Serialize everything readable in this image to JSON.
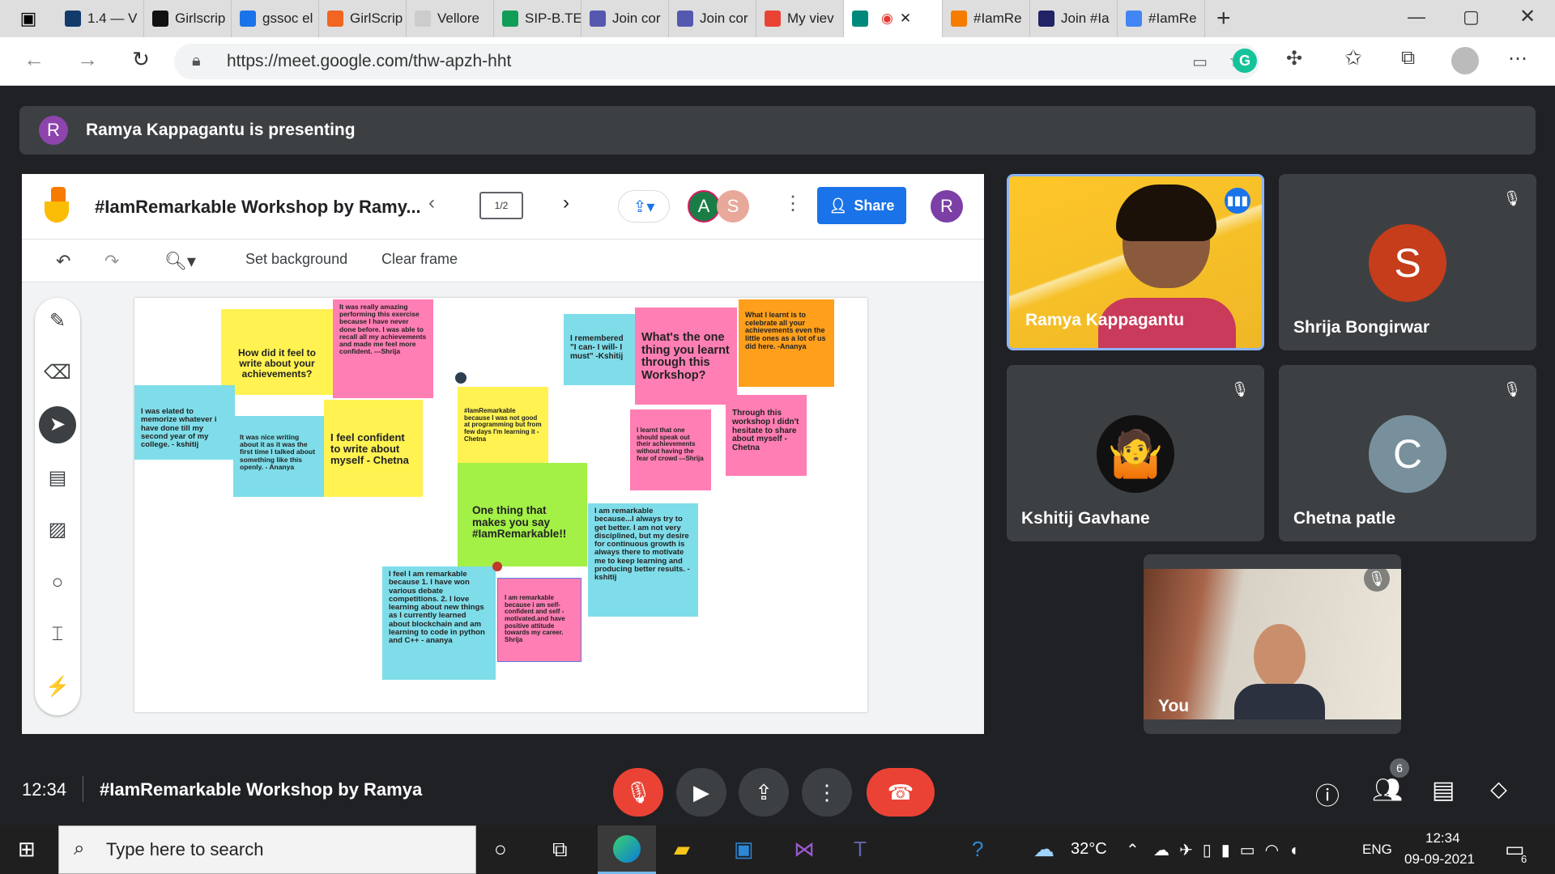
{
  "browser": {
    "tabs": [
      {
        "label": "1.4 — V",
        "color": "#123a6b"
      },
      {
        "label": "Girlscrip",
        "color": "#111111"
      },
      {
        "label": "gssoc el",
        "color": "#1a73e8"
      },
      {
        "label": "GirlScrip",
        "color": "#f26522"
      },
      {
        "label": "Vellore",
        "color": "#cccccc"
      },
      {
        "label": "SIP-B.TE",
        "color": "#0f9d58"
      },
      {
        "label": "Join cor",
        "color": "#5558af"
      },
      {
        "label": "Join cor",
        "color": "#5558af"
      },
      {
        "label": "My viev",
        "color": "#ea4335"
      },
      {
        "label": "",
        "color": "#00897b"
      },
      {
        "label": "#IamRe",
        "color": "#f57c00"
      },
      {
        "label": "Join #Ia",
        "color": "#222266"
      },
      {
        "label": "#IamRe",
        "color": "#4285f4"
      }
    ],
    "url": "https://meet.google.com/thw-apzh-hht"
  },
  "banner": {
    "avatar_letter": "R",
    "text": "Ramya Kappagantu is presenting"
  },
  "jamboard": {
    "title": "#IamRemarkable Workshop by Ramy...",
    "frame_indicator": "1/2",
    "avatars": [
      {
        "letter": "A",
        "color": "#1b7d46"
      },
      {
        "letter": "S",
        "color": "#e8a89a"
      }
    ],
    "share_label": "Share",
    "user_letter": "R",
    "set_background_label": "Set background",
    "clear_frame_label": "Clear frame",
    "notes": [
      {
        "text": "How did it feel to write about your achievements?",
        "color": "y"
      },
      {
        "text": "It was really amazing performing this exercise because I have never done before. I was able to recall all my achievements and made me feel more confident. ---Shrija",
        "color": "p"
      },
      {
        "text": "I remembered \"I can- I will- I must\" -Kshitij",
        "color": "c"
      },
      {
        "text": "What's the one thing you learnt through this Workshop?",
        "color": "p"
      },
      {
        "text": "What I learnt is to celebrate all your achievements even the little ones as a lot of us did here. -Ananya",
        "color": "o"
      },
      {
        "text": "I was elated to memorize whatever i have done till my second year of my college. - kshitij",
        "color": "c"
      },
      {
        "text": "It was nice writing about it as it was the first time I talked about something like this openly. - Ananya",
        "color": "c"
      },
      {
        "text": "I feel confident to write about myself - Chetna",
        "color": "y"
      },
      {
        "text": "#IamRemarkable because I was not good at programming but from few days I'm learning it - Chetna",
        "color": "y"
      },
      {
        "text": "I learnt that one should speak out their achievements without having the fear of crowd ---Shrija",
        "color": "p"
      },
      {
        "text": "Through this workshop I didn't hesitate to share about myself - Chetna",
        "color": "p"
      },
      {
        "text": "One thing that makes you say #IamRemarkable!!",
        "color": "g"
      },
      {
        "text": "I am remarkable because...I always try to get better. I am not very disciplined, but my desire for continuous growth is always there to motivate me to keep learning and producing better results. - kshitij",
        "color": "c"
      },
      {
        "text": "I feel I am remarkable because 1. I have won various debate competitions. 2. I love learning about new things as I currently learned about blockchain and am learning to code in python and C++ - ananya",
        "color": "c"
      },
      {
        "text": "I am remarkable because i am self-confident and self - motivated.and have positive attitude towards my career. Shrija",
        "color": "p"
      }
    ]
  },
  "participants": [
    {
      "name": "Ramya Kappagantu",
      "type": "video",
      "speaking": true
    },
    {
      "name": "Shrija Bongirwar",
      "letter": "S",
      "color": "#c53d1b",
      "muted": true
    },
    {
      "name": "Kshitij Gavhane",
      "type": "memoji",
      "muted": true
    },
    {
      "name": "Chetna patle",
      "letter": "C",
      "color": "#78909c",
      "muted": true
    },
    {
      "name": "You",
      "type": "video",
      "muted": true
    }
  ],
  "bottom": {
    "time": "12:34",
    "meeting_title": "#IamRemarkable Workshop by Ramya",
    "people_count": "6"
  },
  "taskbar": {
    "search_placeholder": "Type here to search",
    "temperature": "32°C",
    "language": "ENG",
    "time": "12:34",
    "date": "09-09-2021",
    "notification_count": "6"
  }
}
